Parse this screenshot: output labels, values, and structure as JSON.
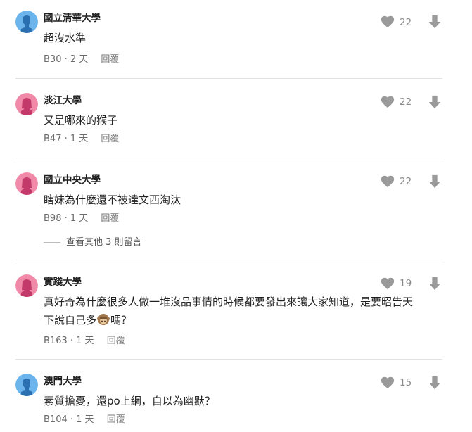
{
  "comments": [
    {
      "school": "國立清華大學",
      "text": "超沒水準",
      "floor": "B30",
      "time": "2 天",
      "reply": "回覆",
      "likes": "22",
      "avatar_color": "#6cb4ec",
      "gender": "male"
    },
    {
      "school": "淡江大學",
      "text": "又是哪來的猴子",
      "floor": "B47",
      "time": "1 天",
      "reply": "回覆",
      "likes": "22",
      "avatar_color": "#f08aa8",
      "gender": "female"
    },
    {
      "school": "國立中央大學",
      "text": "瞎妹為什麼還不被達文西淘汰",
      "floor": "B98",
      "time": "1 天",
      "reply": "回覆",
      "likes": "22",
      "avatar_color": "#f08aa8",
      "gender": "female"
    },
    {
      "school": "實踐大學",
      "text_part1": "真好奇為什麼很多人做一堆沒品事情的時候都要發出來讓大家知道，是要昭告天",
      "text_part2_a": "下說自己多",
      "text_part2_b": "嗎？",
      "floor": "B163",
      "time": "1 天",
      "reply": "回覆",
      "likes": "19",
      "avatar_color": "#f08aa8",
      "gender": "female",
      "emoji": "monkey-icon"
    },
    {
      "school": "澳門大學",
      "text": "素質擔憂，還po上網，自以為幽默？",
      "floor": "B104",
      "time": "1 天",
      "reply": "回覆",
      "likes": "15",
      "avatar_color": "#6cb4ec",
      "gender": "male"
    }
  ],
  "more_replies": "查看其他 3 則留言",
  "colors": {
    "icon": "#9a9a9a",
    "divider": "#e2e2e2"
  }
}
